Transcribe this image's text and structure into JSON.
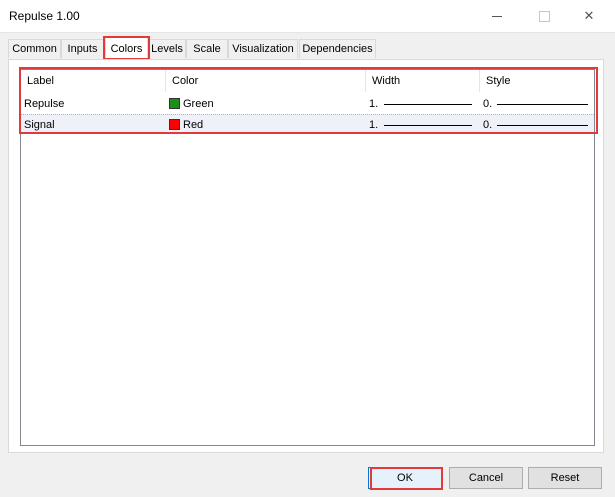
{
  "window": {
    "title": "Repulse 1.00"
  },
  "tabs": [
    {
      "label": "Common"
    },
    {
      "label": "Inputs"
    },
    {
      "label": "Colors",
      "active": true
    },
    {
      "label": "Levels"
    },
    {
      "label": "Scale"
    },
    {
      "label": "Visualization"
    },
    {
      "label": "Dependencies"
    }
  ],
  "table": {
    "columns": [
      "Label",
      "Color",
      "Width",
      "Style"
    ],
    "rows": [
      {
        "label": "Repulse",
        "color_name": "Green",
        "color_hex": "#1a8f1a",
        "width": "1.",
        "style": "0."
      },
      {
        "label": "Signal",
        "color_name": "Red",
        "color_hex": "#ff0000",
        "width": "1.",
        "style": "0."
      }
    ]
  },
  "buttons": {
    "ok": "OK",
    "cancel": "Cancel",
    "reset": "Reset"
  },
  "colors": {
    "highlight": "#e23a3a",
    "selected_row": "#eef1f8"
  }
}
